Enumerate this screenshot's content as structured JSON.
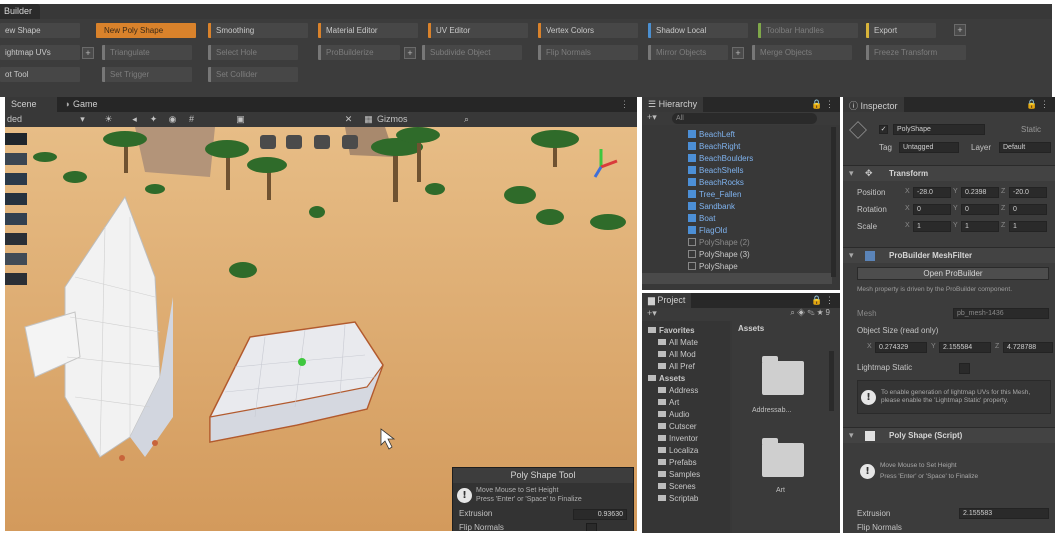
{
  "probuilder": {
    "window_tab": "Builder",
    "row1": [
      {
        "label": "ew Shape",
        "style": "plain"
      },
      {
        "label": "New Poly Shape",
        "style": "selected"
      },
      {
        "label": "Smoothing",
        "style": "orange"
      },
      {
        "label": "Material Editor",
        "style": "orange"
      },
      {
        "label": "UV Editor",
        "style": "orange"
      },
      {
        "label": "Vertex Colors",
        "style": "orange"
      },
      {
        "label": "Shadow Local",
        "style": "blue"
      },
      {
        "label": "Toolbar Handles",
        "style": "green"
      },
      {
        "label": "Export",
        "style": "yellow"
      }
    ],
    "row2": [
      {
        "label": "ightmap UVs",
        "style": "plain"
      },
      {
        "label": "Triangulate",
        "style": "dim"
      },
      {
        "label": "Select Hole",
        "style": "dim"
      },
      {
        "label": "ProBuilderize",
        "style": "dim"
      },
      {
        "label": "Subdivide Object",
        "style": "dim"
      },
      {
        "label": "Flip Normals",
        "style": "dim"
      },
      {
        "label": "Mirror Objects",
        "style": "dim"
      },
      {
        "label": "Merge Objects",
        "style": "dim"
      },
      {
        "label": "Freeze Transform",
        "style": "dim"
      }
    ],
    "row3": [
      {
        "label": "ot Tool",
        "style": "plain"
      },
      {
        "label": "Set Trigger",
        "style": "dim"
      },
      {
        "label": "Set Collider",
        "style": "dim"
      }
    ]
  },
  "scene": {
    "tab_scene": "Scene",
    "tab_game": "Game",
    "shading_mode": "ded",
    "gizmos_label": "Gizmos",
    "poly_tool": {
      "title": "Poly Shape Tool",
      "help_line1": "Move Mouse to Set Height",
      "help_line2": "Press 'Enter' or 'Space' to Finalize",
      "extrusion_label": "Extrusion",
      "extrusion_value": "0.93630",
      "flip_normals_label": "Flip Normals"
    }
  },
  "hierarchy": {
    "tab": "Hierarchy",
    "search_placeholder": "All",
    "items": [
      {
        "name": "BeachLeft",
        "kind": "prefab"
      },
      {
        "name": "BeachRight",
        "kind": "prefab"
      },
      {
        "name": "BeachBoulders",
        "kind": "prefab"
      },
      {
        "name": "BeachShells",
        "kind": "prefab"
      },
      {
        "name": "BeachRocks",
        "kind": "prefab"
      },
      {
        "name": "Tree_Fallen",
        "kind": "prefab"
      },
      {
        "name": "Sandbank",
        "kind": "prefab"
      },
      {
        "name": "Boat",
        "kind": "prefab"
      },
      {
        "name": "FlagOld",
        "kind": "prefab"
      },
      {
        "name": "PolyShape (2)",
        "kind": "grey"
      },
      {
        "name": "PolyShape (3)",
        "kind": "plain"
      },
      {
        "name": "PolyShape",
        "kind": "plain"
      }
    ]
  },
  "project": {
    "tab": "Project",
    "tree": [
      {
        "label": "Favorites",
        "indent": 0,
        "bold": true
      },
      {
        "label": "All Mate",
        "indent": 1
      },
      {
        "label": "All Mod",
        "indent": 1
      },
      {
        "label": "All Pref",
        "indent": 1
      },
      {
        "label": "Assets",
        "indent": 0,
        "bold": true
      },
      {
        "label": "Address",
        "indent": 1
      },
      {
        "label": "Art",
        "indent": 1
      },
      {
        "label": "Audio",
        "indent": 1
      },
      {
        "label": "Cutscer",
        "indent": 1
      },
      {
        "label": "Inventor",
        "indent": 1
      },
      {
        "label": "Localiza",
        "indent": 1
      },
      {
        "label": "Prefabs",
        "indent": 1
      },
      {
        "label": "Samples",
        "indent": 1
      },
      {
        "label": "Scenes",
        "indent": 1
      },
      {
        "label": "Scriptab",
        "indent": 1
      }
    ],
    "content_header": "Assets",
    "folders": [
      "Addressab...",
      "Art"
    ]
  },
  "inspector": {
    "tab": "Inspector",
    "object_name": "PolyShape",
    "static_label": "Static",
    "tag_label": "Tag",
    "tag_value": "Untagged",
    "layer_label": "Layer",
    "layer_value": "Default",
    "transform": {
      "title": "Transform",
      "position_label": "Position",
      "rotation_label": "Rotation",
      "scale_label": "Scale",
      "position": [
        "-28.0",
        "0.2398",
        "-20.0"
      ],
      "rotation": [
        "0",
        "0",
        "0"
      ],
      "scale": [
        "1",
        "1",
        "1"
      ]
    },
    "meshfilter": {
      "title": "ProBuilder MeshFilter",
      "open_button": "Open ProBuilder",
      "note": "Mesh property is driven by the ProBuilder component.",
      "mesh_label": "Mesh",
      "mesh_value": "pb_mesh-1436",
      "size_label": "Object Size (read only)",
      "size_x": "0.274329",
      "size_y": "2.155584",
      "size_z": "4.728788",
      "lightmap_label": "Lightmap Static",
      "lightmap_help": "To enable generation of lightmap UVs for this Mesh, please enable the 'Lightmap Static' property."
    },
    "polyshape": {
      "title": "Poly Shape (Script)",
      "help_line1": "Move Mouse to Set Height",
      "help_line2": "Press 'Enter' or 'Space' to Finalize",
      "extrusion_label": "Extrusion",
      "extrusion_value": "2.155583",
      "flip_normals_label": "Flip Normals"
    }
  },
  "colors": {
    "sand": "#dca568",
    "selection_orange": "#d9822b",
    "prefab_blue": "#4c8fd6"
  }
}
